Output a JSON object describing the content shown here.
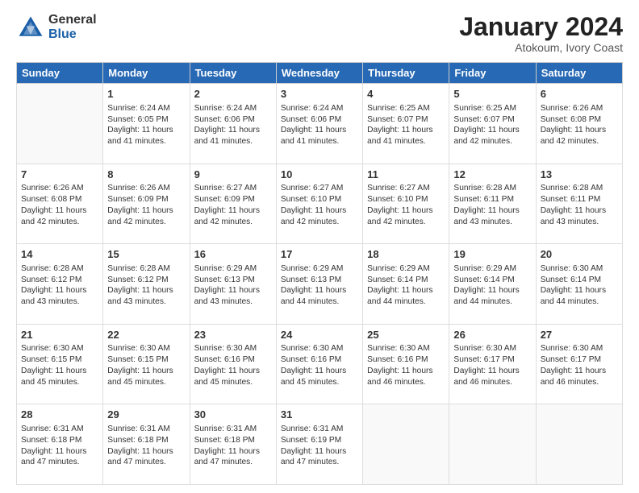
{
  "logo": {
    "general": "General",
    "blue": "Blue"
  },
  "header": {
    "month": "January 2024",
    "location": "Atokoum, Ivory Coast"
  },
  "weekdays": [
    "Sunday",
    "Monday",
    "Tuesday",
    "Wednesday",
    "Thursday",
    "Friday",
    "Saturday"
  ],
  "weeks": [
    [
      {
        "day": "",
        "info": ""
      },
      {
        "day": "1",
        "info": "Sunrise: 6:24 AM\nSunset: 6:05 PM\nDaylight: 11 hours\nand 41 minutes."
      },
      {
        "day": "2",
        "info": "Sunrise: 6:24 AM\nSunset: 6:06 PM\nDaylight: 11 hours\nand 41 minutes."
      },
      {
        "day": "3",
        "info": "Sunrise: 6:24 AM\nSunset: 6:06 PM\nDaylight: 11 hours\nand 41 minutes."
      },
      {
        "day": "4",
        "info": "Sunrise: 6:25 AM\nSunset: 6:07 PM\nDaylight: 11 hours\nand 41 minutes."
      },
      {
        "day": "5",
        "info": "Sunrise: 6:25 AM\nSunset: 6:07 PM\nDaylight: 11 hours\nand 42 minutes."
      },
      {
        "day": "6",
        "info": "Sunrise: 6:26 AM\nSunset: 6:08 PM\nDaylight: 11 hours\nand 42 minutes."
      }
    ],
    [
      {
        "day": "7",
        "info": "Sunrise: 6:26 AM\nSunset: 6:08 PM\nDaylight: 11 hours\nand 42 minutes."
      },
      {
        "day": "8",
        "info": "Sunrise: 6:26 AM\nSunset: 6:09 PM\nDaylight: 11 hours\nand 42 minutes."
      },
      {
        "day": "9",
        "info": "Sunrise: 6:27 AM\nSunset: 6:09 PM\nDaylight: 11 hours\nand 42 minutes."
      },
      {
        "day": "10",
        "info": "Sunrise: 6:27 AM\nSunset: 6:10 PM\nDaylight: 11 hours\nand 42 minutes."
      },
      {
        "day": "11",
        "info": "Sunrise: 6:27 AM\nSunset: 6:10 PM\nDaylight: 11 hours\nand 42 minutes."
      },
      {
        "day": "12",
        "info": "Sunrise: 6:28 AM\nSunset: 6:11 PM\nDaylight: 11 hours\nand 43 minutes."
      },
      {
        "day": "13",
        "info": "Sunrise: 6:28 AM\nSunset: 6:11 PM\nDaylight: 11 hours\nand 43 minutes."
      }
    ],
    [
      {
        "day": "14",
        "info": "Sunrise: 6:28 AM\nSunset: 6:12 PM\nDaylight: 11 hours\nand 43 minutes."
      },
      {
        "day": "15",
        "info": "Sunrise: 6:28 AM\nSunset: 6:12 PM\nDaylight: 11 hours\nand 43 minutes."
      },
      {
        "day": "16",
        "info": "Sunrise: 6:29 AM\nSunset: 6:13 PM\nDaylight: 11 hours\nand 43 minutes."
      },
      {
        "day": "17",
        "info": "Sunrise: 6:29 AM\nSunset: 6:13 PM\nDaylight: 11 hours\nand 44 minutes."
      },
      {
        "day": "18",
        "info": "Sunrise: 6:29 AM\nSunset: 6:14 PM\nDaylight: 11 hours\nand 44 minutes."
      },
      {
        "day": "19",
        "info": "Sunrise: 6:29 AM\nSunset: 6:14 PM\nDaylight: 11 hours\nand 44 minutes."
      },
      {
        "day": "20",
        "info": "Sunrise: 6:30 AM\nSunset: 6:14 PM\nDaylight: 11 hours\nand 44 minutes."
      }
    ],
    [
      {
        "day": "21",
        "info": "Sunrise: 6:30 AM\nSunset: 6:15 PM\nDaylight: 11 hours\nand 45 minutes."
      },
      {
        "day": "22",
        "info": "Sunrise: 6:30 AM\nSunset: 6:15 PM\nDaylight: 11 hours\nand 45 minutes."
      },
      {
        "day": "23",
        "info": "Sunrise: 6:30 AM\nSunset: 6:16 PM\nDaylight: 11 hours\nand 45 minutes."
      },
      {
        "day": "24",
        "info": "Sunrise: 6:30 AM\nSunset: 6:16 PM\nDaylight: 11 hours\nand 45 minutes."
      },
      {
        "day": "25",
        "info": "Sunrise: 6:30 AM\nSunset: 6:16 PM\nDaylight: 11 hours\nand 46 minutes."
      },
      {
        "day": "26",
        "info": "Sunrise: 6:30 AM\nSunset: 6:17 PM\nDaylight: 11 hours\nand 46 minutes."
      },
      {
        "day": "27",
        "info": "Sunrise: 6:30 AM\nSunset: 6:17 PM\nDaylight: 11 hours\nand 46 minutes."
      }
    ],
    [
      {
        "day": "28",
        "info": "Sunrise: 6:31 AM\nSunset: 6:18 PM\nDaylight: 11 hours\nand 47 minutes."
      },
      {
        "day": "29",
        "info": "Sunrise: 6:31 AM\nSunset: 6:18 PM\nDaylight: 11 hours\nand 47 minutes."
      },
      {
        "day": "30",
        "info": "Sunrise: 6:31 AM\nSunset: 6:18 PM\nDaylight: 11 hours\nand 47 minutes."
      },
      {
        "day": "31",
        "info": "Sunrise: 6:31 AM\nSunset: 6:19 PM\nDaylight: 11 hours\nand 47 minutes."
      },
      {
        "day": "",
        "info": ""
      },
      {
        "day": "",
        "info": ""
      },
      {
        "day": "",
        "info": ""
      }
    ]
  ]
}
